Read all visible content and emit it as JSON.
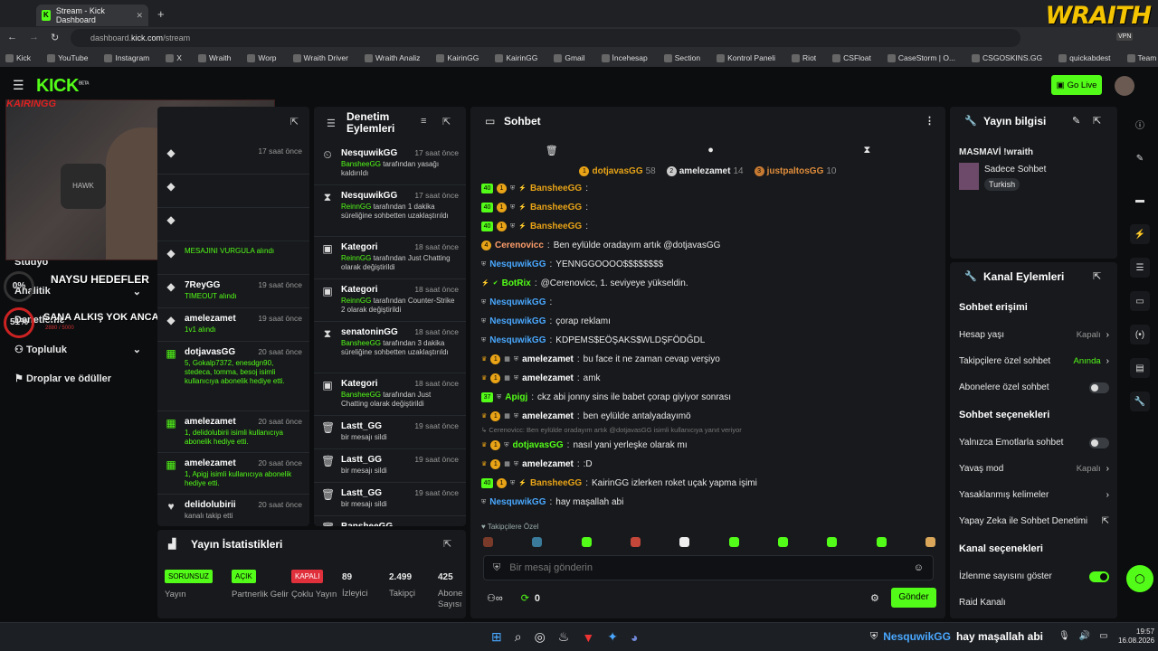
{
  "browser": {
    "tab_title": "Stream - Kick Dashboard",
    "url_host": "dashboard.",
    "url_domain": "kick.com",
    "url_path": "/stream",
    "brand": "WRAITH",
    "vpn": "VPN"
  },
  "bookmarks": [
    "Kick",
    "YouTube",
    "Instagram",
    "X",
    "Wraith",
    "Worp",
    "Wraith Driver",
    "Wraith Analiz",
    "KairinGG",
    "KairinGG",
    "Gmail",
    "İncehesap",
    "Section",
    "Kontrol Paneli",
    "Riot",
    "CSFloat",
    "CaseStorm | O...",
    "CSGOSKINS.GG",
    "quickabdest",
    "Team Venture |...",
    "Matchmaking"
  ],
  "header": {
    "logo": "KICK",
    "beta": "BETA",
    "go_live": "Go Live"
  },
  "overlay": {
    "cam_name": "KAIRINGG",
    "goals_title": "NAYSU HEDEFLER",
    "goal1_pct": "0%",
    "goal2_pct": "51%",
    "goal2_sub": "2880 / 5000",
    "goal2_title": "SANA ALKIŞ YOK ANCA KICK"
  },
  "sidenav": {
    "items": [
      "Stüdyo",
      "Analitik",
      "Denetleme",
      "Topluluk",
      "Droplar ve ödüller"
    ]
  },
  "feed": {
    "items": [
      {
        "name": "",
        "time": "17 saat önce",
        "text": "",
        "icon": "◆"
      },
      {
        "name": "",
        "time": "",
        "text": "",
        "icon": "◆"
      },
      {
        "name": "",
        "time": "",
        "text": "",
        "icon": "◆"
      },
      {
        "name": "",
        "time": "",
        "text": "MESAJINI VURGULA alındı",
        "icon": "◆"
      },
      {
        "name": "7ReyGG",
        "time": "19 saat önce",
        "text": "TIMEOUT alındı",
        "icon": "◆"
      },
      {
        "name": "amelezamet",
        "time": "19 saat önce",
        "text": "1v1 alındı",
        "icon": "◆"
      },
      {
        "name": "dotjavasGG",
        "time": "20 saat önce",
        "text": "5, Gokalp7372, enesdgn90, stedeca, tomma, besoj isimli kullanıcıya abonelik hediye etti.",
        "icon": "▦"
      },
      {
        "name": "amelezamet",
        "time": "20 saat önce",
        "text": "1, delidolubirii isimli kullanıcıya abonelik hediye etti.",
        "icon": "▦"
      },
      {
        "name": "amelezamet",
        "time": "20 saat önce",
        "text": "1, Apigj isimli kullanıcıya abonelik hediye etti.",
        "icon": "▦"
      },
      {
        "name": "delidolubirii",
        "time": "20 saat önce",
        "text": "kanalı takip etti",
        "icon": "♥"
      }
    ]
  },
  "denetim": {
    "title1": "Denetim",
    "title2": "Eylemleri",
    "items": [
      {
        "name": "NesquwikGG",
        "time": "17 saat önce",
        "g": "BansheeGG",
        "t": " tarafından yasağı kaldırıldı",
        "icon": "⏲"
      },
      {
        "name": "NesquwikGG",
        "time": "17 saat önce",
        "g": "ReinnGG",
        "t": " tarafından 1 dakika süreliğine sohbetten uzaklaştırıldı",
        "icon": "⧗"
      },
      {
        "name": "Kategori",
        "time": "18 saat önce",
        "g": "ReinnGG",
        "t": " tarafından Just Chatting olarak değiştirildi",
        "icon": "▣"
      },
      {
        "name": "Kategori",
        "time": "18 saat önce",
        "g": "ReinnGG",
        "t": " tarafından Counter-Strike 2 olarak değiştirildi",
        "icon": "▣"
      },
      {
        "name": "senatoninGG",
        "time": "18 saat önce",
        "g": "BansheeGG",
        "t": " tarafından 3 dakika süreliğine sohbetten uzaklaştırıldı",
        "icon": "⧗"
      },
      {
        "name": "Kategori",
        "time": "18 saat önce",
        "g": "BansheeGG",
        "t": " tarafından Just Chatting olarak değiştirildi",
        "icon": "▣"
      },
      {
        "name": "Lastt_GG",
        "time": "19 saat önce",
        "g": "",
        "t": "bir mesajı sildi",
        "icon": "🗑"
      },
      {
        "name": "Lastt_GG",
        "time": "19 saat önce",
        "g": "",
        "t": "bir mesajı sildi",
        "icon": "🗑"
      },
      {
        "name": "Lastt_GG",
        "time": "19 saat önce",
        "g": "",
        "t": "bir mesajı sildi",
        "icon": "🗑"
      },
      {
        "name": "BansheeGG",
        "time": "",
        "g": "",
        "t": "",
        "icon": "🗑"
      }
    ]
  },
  "stats": {
    "title": "Yayın İstatistikleri",
    "items": [
      {
        "badge": "SORUNSUZ",
        "label": "Yayın",
        "color": "#53fc18"
      },
      {
        "badge": "AÇIK",
        "label": "Partnerlik Gelir",
        "color": "#53fc18"
      },
      {
        "badge": "KAPALI",
        "label": "Çoklu Yayın",
        "color": "#e0303c"
      },
      {
        "value": "89",
        "label": "İzleyici"
      },
      {
        "value": "2.499",
        "label": "Takipçi"
      },
      {
        "value": "425",
        "label": "Abone Sayısı"
      }
    ]
  },
  "chat": {
    "title": "Sohbet",
    "leaders": [
      {
        "rank": "1",
        "name": "dotjavasGG",
        "n": "58"
      },
      {
        "rank": "2",
        "name": "amelezamet",
        "n": "14"
      },
      {
        "rank": "3",
        "name": "justpaltosGG",
        "n": "10"
      }
    ],
    "messages": [
      {
        "b": [
          "40",
          "1",
          "⛨",
          "⚡"
        ],
        "user": "BansheeGG",
        "color": "#e8a317",
        "text": ""
      },
      {
        "b": [
          "40",
          "1",
          "⛨",
          "⚡"
        ],
        "user": "BansheeGG",
        "color": "#e8a317",
        "text": ""
      },
      {
        "b": [
          "40",
          "1",
          "⛨",
          "⚡"
        ],
        "user": "BansheeGG",
        "color": "#e8a317",
        "text": ""
      },
      {
        "b": [
          "4"
        ],
        "user": "Cerenovicc",
        "color": "#ff9e6b",
        "text": "Ben eylülde oradayım artık @dotjavasGG"
      },
      {
        "b": [
          "⛨"
        ],
        "user": "NesquwikGG",
        "color": "#4aa8ff",
        "text": "YENNGGOOOO$$$$$$$$"
      },
      {
        "b": [
          "⚡",
          "✔"
        ],
        "user": "BotRix",
        "color": "#53fc18",
        "text": "@Cerenovicc, 1. seviyeye yükseldin."
      },
      {
        "b": [
          "⛨"
        ],
        "user": "NesquwikGG",
        "color": "#4aa8ff",
        "text": ""
      },
      {
        "b": [
          "⛨"
        ],
        "user": "NesquwikGG",
        "color": "#4aa8ff",
        "text": "çorap reklamı"
      },
      {
        "b": [
          "⛨"
        ],
        "user": "NesquwikGG",
        "color": "#4aa8ff",
        "text": "KDPEMS$EÖŞAKS$WLDŞFÖDĞDL"
      },
      {
        "b": [
          "♛",
          "1",
          "▦",
          "⛨"
        ],
        "user": "amelezamet",
        "color": "#ffffff",
        "text": "bu face it ne zaman cevap verşiyo"
      },
      {
        "b": [
          "♛",
          "1",
          "▦",
          "⛨"
        ],
        "user": "amelezamet",
        "color": "#ffffff",
        "text": "amk"
      },
      {
        "b": [
          "37",
          "⛨"
        ],
        "user": "Apigj",
        "color": "#53fc18",
        "text": "ckz abi jonny sins ile babet çorap giyiyor sonrası"
      },
      {
        "b": [
          "♛",
          "1",
          "▦",
          "⛨"
        ],
        "user": "amelezamet",
        "color": "#ffffff",
        "text": "ben eylülde antalyadayımö"
      },
      {
        "reply": "↳ Cerenovicc: Ben eylülde oradayım artık @dotjavasGG isimli kullanıcıya yanıt veriyor"
      },
      {
        "b": [
          "♛",
          "1",
          "⛨"
        ],
        "user": "dotjavasGG",
        "color": "#53fc18",
        "text": "nasıl yani yerleşke olarak mı"
      },
      {
        "b": [
          "♛",
          "1",
          "▦",
          "⛨"
        ],
        "user": "amelezamet",
        "color": "#ffffff",
        "text": ":D"
      },
      {
        "b": [
          "40",
          "1",
          "⛨",
          "⚡"
        ],
        "user": "BansheeGG",
        "color": "#e8a317",
        "text": "KairinGG izlerken roket uçak yapma işimi"
      },
      {
        "b": [
          "⛨"
        ],
        "user": "NesquwikGG",
        "color": "#4aa8ff",
        "text": "hay maşallah abi"
      }
    ],
    "followers_only": "♥ Takipçilere Özel",
    "placeholder": "Bir mesaj gönderin",
    "points": "0",
    "send": "Gönder"
  },
  "info": {
    "title": "Yayın bilgisi",
    "stream_title": "MASMAVİ !wraith",
    "category": "Sadece Sohbet",
    "language": "Turkish"
  },
  "channel": {
    "title": "Kanal Eylemleri",
    "sec1": "Sohbet erişimi",
    "rows1": [
      {
        "label": "Hesap yaşı",
        "value": "Kapalı",
        "type": "chev"
      },
      {
        "label": "Takipçilere özel sohbet",
        "value": "Anında",
        "type": "chevg"
      },
      {
        "label": "Abonelere özel sohbet",
        "value": "",
        "type": "toggle"
      }
    ],
    "sec2": "Sohbet seçenekleri",
    "rows2": [
      {
        "label": "Yalnızca Emotlarla sohbet",
        "value": "",
        "type": "toggle"
      },
      {
        "label": "Yavaş mod",
        "value": "Kapalı",
        "type": "chev"
      },
      {
        "label": "Yasaklanmış kelimeler",
        "value": "",
        "type": "chev"
      },
      {
        "label": "Yapay Zeka ile Sohbet Denetimi",
        "value": "",
        "type": "ext"
      }
    ],
    "sec3": "Kanal seçenekleri",
    "rows3": [
      {
        "label": "İzlenme sayısını göster",
        "value": "",
        "type": "toggleon"
      },
      {
        "label": "Raid Kanalı",
        "value": "",
        "type": "none"
      }
    ]
  },
  "taskbar": {
    "ticker_user": "NesquwikGG",
    "ticker_msg": "hay maşallah abi",
    "time": "19:57",
    "date": "16.08.2026"
  }
}
